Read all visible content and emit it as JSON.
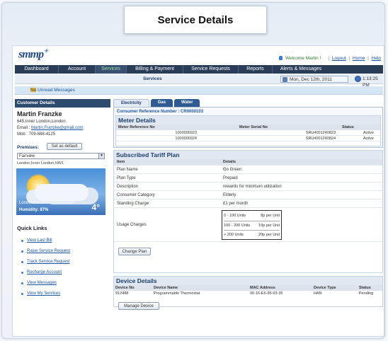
{
  "page_title": "Service Details",
  "logo_text": "smmp",
  "header": {
    "welcome": "Welcome Martin !",
    "logout": "Logout",
    "home": "Home",
    "help": "Help"
  },
  "nav": [
    "Dashboard",
    "Account",
    "Services",
    "Billing & Payment",
    "Service Requests",
    "Reports",
    "Alerts & Messages"
  ],
  "nav_active": "Services",
  "subbar": {
    "label": "Services",
    "date": "Mon, Dec 12th, 2011",
    "time": "1:13:25 PM"
  },
  "messages": "No Unread Messages",
  "customer": {
    "header": "Customer Details",
    "name": "Martin Franzke",
    "address": "645,Inner London,London",
    "email_label": "Email :",
    "email": "Martin.Franzke@gmail.com",
    "mob": "Mob : 709-888-4125",
    "premises_label": "Premises:",
    "set_default": "Set as default",
    "premise_selected": "Fairview",
    "location": "London,Inner London,NW1"
  },
  "weather": {
    "city": "London",
    "humidity": "Humidity: 87%",
    "temp": "4°"
  },
  "quick_links": {
    "title": "Quick Links",
    "items": [
      "View Last Bill",
      "Raise Service Request",
      "Track Service Request",
      "Recharge Account",
      "View Messages",
      "View My Services"
    ]
  },
  "tabs": [
    "Electricity",
    "Gas",
    "Water"
  ],
  "consumer_ref": "Consumer Reference Number : CR0000103",
  "meter": {
    "title": "Meter Details",
    "columns": [
      "Meter Reference No",
      "Meter Serial No",
      "Status"
    ],
    "rows": [
      [
        "1000000923",
        "SRU4001240823",
        "Active"
      ],
      [
        "1000000924",
        "SRU4001240824",
        "Active"
      ]
    ]
  },
  "tariff": {
    "title": "Subscribed Tariff Plan",
    "columns": [
      "Item",
      "Details"
    ],
    "rows": [
      [
        "Plan Name",
        "Go Green"
      ],
      [
        "Plan Type",
        "Prepaid"
      ],
      [
        "Description",
        "rewards for minimum utilization"
      ],
      [
        "Consumer Category",
        "Elderly"
      ],
      [
        "Standing Charge",
        "£1 per month"
      ]
    ],
    "usage_label": "Usage Charges",
    "usage": [
      [
        "0 - 100 Units",
        "8p per Unit"
      ],
      [
        "100 - 200 Units",
        "10p per Unit"
      ],
      [
        "> 200 Units",
        "20p per Unit"
      ]
    ],
    "change_plan": "Change Plan"
  },
  "device": {
    "title": "Device Details",
    "columns": [
      "Device No",
      "Device Name",
      "MAC Address",
      "Device Type",
      "Status"
    ],
    "rows": [
      [
        "912488",
        "Programmable Thermostat",
        "00-16-E6-95-93-35",
        "HAN",
        "Pending"
      ]
    ],
    "manage": "Manage Device"
  }
}
